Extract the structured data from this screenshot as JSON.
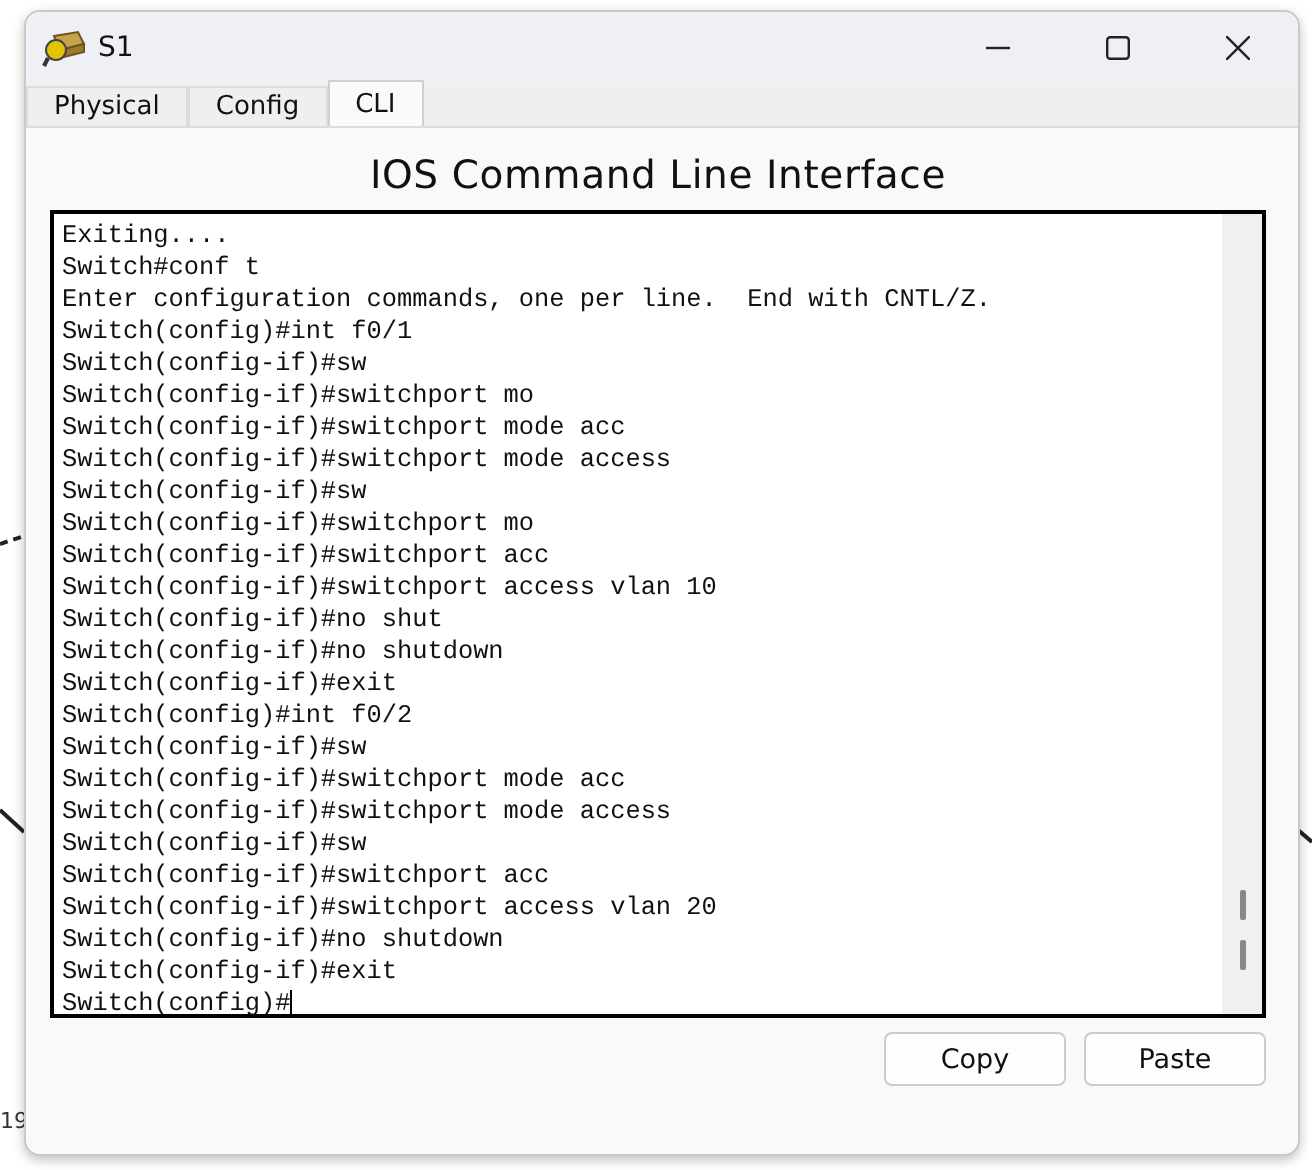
{
  "background_labels": [
    "19"
  ],
  "window": {
    "title": "S1"
  },
  "tabs": [
    {
      "label": "Physical",
      "selected": false
    },
    {
      "label": "Config",
      "selected": false
    },
    {
      "label": "CLI",
      "selected": true
    }
  ],
  "heading": "IOS Command Line Interface",
  "terminal": {
    "cursor": true,
    "lines": [
      "Exiting....",
      "Switch#conf t",
      "Enter configuration commands, one per line.  End with CNTL/Z.",
      "Switch(config)#int f0/1",
      "Switch(config-if)#sw",
      "Switch(config-if)#switchport mo",
      "Switch(config-if)#switchport mode acc",
      "Switch(config-if)#switchport mode access",
      "Switch(config-if)#sw",
      "Switch(config-if)#switchport mo",
      "Switch(config-if)#switchport acc",
      "Switch(config-if)#switchport access vlan 10",
      "Switch(config-if)#no shut",
      "Switch(config-if)#no shutdown",
      "Switch(config-if)#exit",
      "Switch(config)#int f0/2",
      "Switch(config-if)#sw",
      "Switch(config-if)#switchport mode acc",
      "Switch(config-if)#switchport mode access",
      "Switch(config-if)#sw",
      "Switch(config-if)#switchport acc",
      "Switch(config-if)#switchport access vlan 20",
      "Switch(config-if)#no shutdown",
      "Switch(config-if)#exit",
      "Switch(config)#"
    ]
  },
  "buttons": [
    "Copy",
    "Paste"
  ]
}
